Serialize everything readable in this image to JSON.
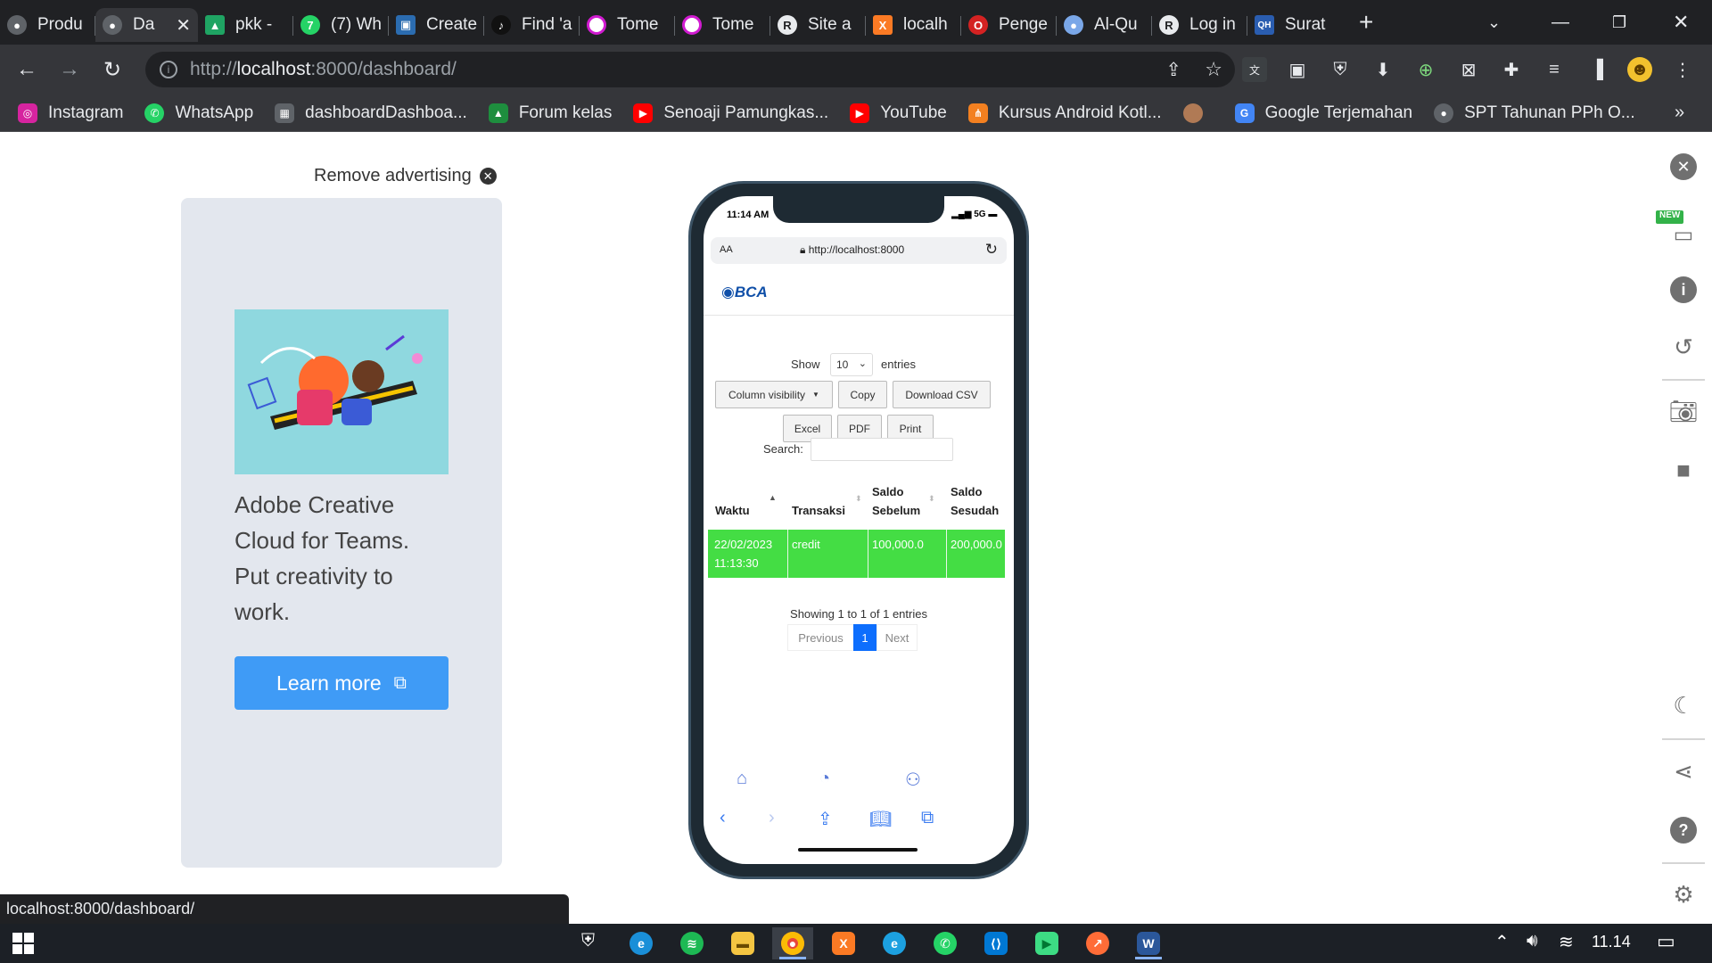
{
  "browser": {
    "tabs": [
      {
        "title": "Produ",
        "icon": "globe-icon",
        "color": "#5f6368"
      },
      {
        "title": "Da",
        "icon": "globe-icon",
        "color": "#5f6368",
        "active": true
      },
      {
        "title": "pkk -",
        "icon": "google-drive-icon",
        "color": "#1fa463"
      },
      {
        "title": "(7) Wh",
        "icon": "whatsapp-icon",
        "color": "#25d366"
      },
      {
        "title": "Create",
        "icon": "presentation-icon",
        "color": "#2b6cb0"
      },
      {
        "title": "Find 'a",
        "icon": "tiktok-icon",
        "color": "#111111"
      },
      {
        "title": "Tome",
        "icon": "tome-icon",
        "color": "#d01bd0"
      },
      {
        "title": "Tome",
        "icon": "tome-icon",
        "color": "#d01bd0"
      },
      {
        "title": "Site a",
        "icon": "site-icon",
        "color": "#e8eaed"
      },
      {
        "title": "localh",
        "icon": "xampp-icon",
        "color": "#fb7a24"
      },
      {
        "title": "Penge",
        "icon": "opera-icon",
        "color": "#d42222"
      },
      {
        "title": "Al-Qu",
        "icon": "globe-icon",
        "color": "#7aa7e8"
      },
      {
        "title": "Log in",
        "icon": "site-icon",
        "color": "#e8eaed"
      },
      {
        "title": "Surat",
        "icon": "qh-icon",
        "color": "#2a5db0"
      }
    ],
    "url_prefix": "http://",
    "url_host": "localhost",
    "url_rest": ":8000/dashboard/",
    "bookmarks": [
      {
        "label": "Instagram",
        "icon": "instagram-icon",
        "color": "#d6249f"
      },
      {
        "label": "WhatsApp",
        "icon": "whatsapp-icon",
        "color": "#25d366"
      },
      {
        "label": "dashboardDashboa...",
        "icon": "page-icon",
        "color": "#5f6368"
      },
      {
        "label": "Forum kelas",
        "icon": "classroom-icon",
        "color": "#1e8e3e"
      },
      {
        "label": "Senoaji Pamungkas...",
        "icon": "youtube-icon",
        "color": "#ff0000"
      },
      {
        "label": "YouTube",
        "icon": "youtube-icon",
        "color": "#ff0000"
      },
      {
        "label": "Kursus Android Kotl...",
        "icon": "android-course-icon",
        "color": "#f38020"
      },
      {
        "label": "",
        "icon": "avatar-icon",
        "color": "#b07a55"
      },
      {
        "label": "Google Terjemahan",
        "icon": "translate-icon",
        "color": "#4285f4"
      },
      {
        "label": "SPT Tahunan PPh O...",
        "icon": "globe-icon",
        "color": "#5f6368"
      }
    ],
    "status_url": "localhost:8000/dashboard/"
  },
  "ad": {
    "remove_label": "Remove advertising",
    "headline": "Adobe Creative Cloud for Teams. Put creativity to work.",
    "cta_label": "Learn more"
  },
  "phone": {
    "time": "11:14 AM",
    "status": "5G",
    "safari_aa": "AA",
    "safari_url": "http://localhost:8000",
    "brand": "BCA",
    "table": {
      "show_label": "Show",
      "entries_value": "10",
      "entries_label": "entries",
      "buttons": [
        "Column visibility",
        "Copy",
        "Download CSV",
        "Excel",
        "PDF",
        "Print"
      ],
      "search_label": "Search:",
      "headers": [
        "Waktu",
        "Transaksi",
        "Saldo Sebelum",
        "Saldo Sesudah"
      ],
      "rows": [
        {
          "waktu_date": "22/02/2023",
          "waktu_time": "11:13:30",
          "transaksi": "credit",
          "saldo_sebelum": "100,000.0",
          "saldo_sesudah": "200,000.0"
        }
      ],
      "row_color": "#44dd44",
      "info": "Showing 1 to 1 of 1 entries",
      "pagination": {
        "previous": "Previous",
        "current": "1",
        "next": "Next"
      }
    }
  },
  "taskbar": {
    "time": "11.14",
    "apps": [
      "edge-icon",
      "spotify-icon",
      "file-explorer-icon",
      "chrome-icon",
      "xampp-icon",
      "edge-dev-icon",
      "whatsapp-icon",
      "vscode-icon",
      "android-studio-icon",
      "postman-icon",
      "word-icon"
    ]
  }
}
